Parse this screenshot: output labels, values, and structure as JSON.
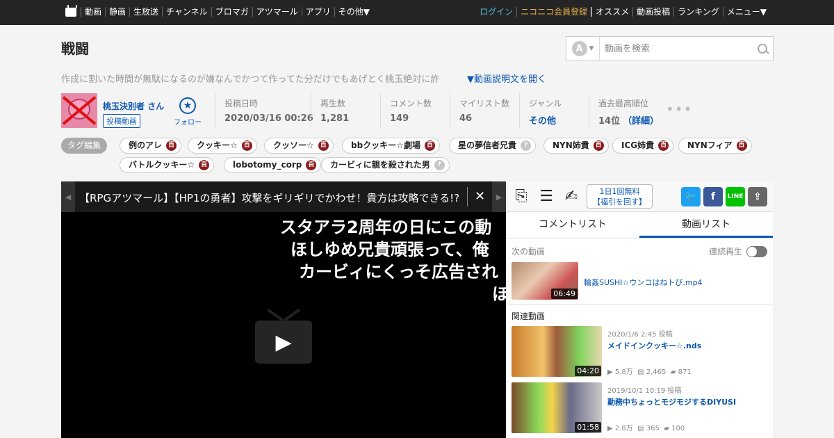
{
  "topbar": {
    "nav": [
      "動画",
      "静画",
      "生放送",
      "チャンネル",
      "ブロマガ",
      "アツマール",
      "アプリ",
      "その他▼"
    ],
    "login": "ログイン",
    "premium": "ニコニコ会員登録",
    "right_nav": [
      "オススメ",
      "動画投稿",
      "ランキング",
      "メニュー▼"
    ]
  },
  "title": "戦闘",
  "search": {
    "placeholder": "動画を検索",
    "mode_icon": "A",
    "mode_arrow": "▼"
  },
  "description": {
    "text": "作成に割いた時間が無駄になるのが嫌なんでかつて作ってた分だけでもあげとく桃玉絶対に許",
    "toggle": "▼動画説明文を開く"
  },
  "owner": {
    "name": "桃玉決別者 さん",
    "videos_button": "投稿動画",
    "follow_label": "フォロー",
    "follow_icon": "star-icon"
  },
  "stats": [
    {
      "label": "投稿日時",
      "value": "2020/03/16 00:26"
    },
    {
      "label": "再生数",
      "value": "1,281"
    },
    {
      "label": "コメント数",
      "value": "149"
    },
    {
      "label": "マイリスト数",
      "value": "46"
    },
    {
      "label": "ジャンル",
      "value": "その他"
    },
    {
      "label": "過去最高順位",
      "value": "14位",
      "detail": "（詳細）"
    }
  ],
  "more_dots": "•••",
  "tag_edit": "タグ編集",
  "tags": [
    {
      "label": "例のアレ",
      "icon": "百"
    },
    {
      "label": "クッキー☆",
      "icon": "百"
    },
    {
      "label": "クッソー☆",
      "icon": "百"
    },
    {
      "label": "bbクッキー☆劇場",
      "icon": "百"
    },
    {
      "label": "星の夢信者兄貴",
      "icon": "?"
    },
    {
      "label": "NYN姉貴",
      "icon": "百"
    },
    {
      "label": "ICG姉貴",
      "icon": "百"
    },
    {
      "label": "NYNフィア",
      "icon": "百"
    },
    {
      "label": "バトルクッキー☆",
      "icon": "百"
    },
    {
      "label": "lobotomy_corp",
      "icon": "百"
    },
    {
      "label": "カービィに親を殺された男",
      "icon": "?"
    }
  ],
  "player": {
    "series_title": "【RPGアツマール】【HP1の勇者】攻撃をギリギリでかわせ！貴方は攻略できる!?",
    "close": "✕",
    "prev": "◀",
    "next": "▶",
    "comments": [
      "スタアラ2周年の日にこの動",
      "ほしゆめ兄貴頑張って、俺",
      "カービィにくっそ広告され",
      "ほ"
    ],
    "play_icon": "▶"
  },
  "side": {
    "fukubiki": [
      "1日1回無料",
      "【福引を回す】"
    ],
    "tabs": [
      "コメントリスト",
      "動画リスト"
    ],
    "active_tab": 1,
    "next_label": "次の動画",
    "continuous": "連続再生",
    "next_video": {
      "title": "輪姦SUSHI☆ウンコはねトび.mp4",
      "duration": "06:49"
    },
    "related_label": "関連動画",
    "related": [
      {
        "date": "2020/1/6 2:45 投稿",
        "title": "メイドインクッキー☆.nds",
        "duration": "04:20",
        "views": "5.8万",
        "comments": "2,465",
        "mylists": "871"
      },
      {
        "date": "2019/10/1 10:19 投稿",
        "title": "勤務中ちょっとモジモジするDIYUSI",
        "duration": "01:58",
        "views": "2.8万",
        "comments": "365",
        "mylists": "100"
      }
    ]
  },
  "colors": {
    "topbar": "#252525",
    "link": "#0b57b0",
    "login": "#4fb8dd",
    "premium": "#e5b04a"
  }
}
